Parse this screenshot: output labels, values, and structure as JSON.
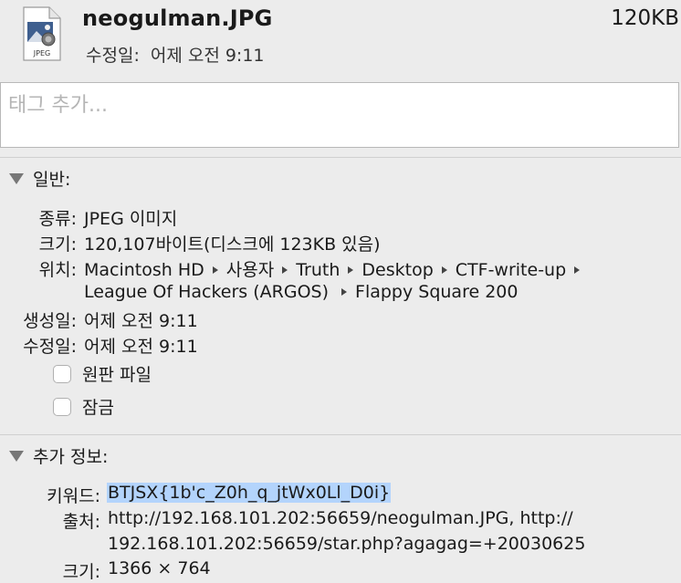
{
  "header": {
    "file_name": "neogulman.JPG",
    "file_size": "120KB",
    "modified_label": "수정일:",
    "modified_value": "어제 오전 9:11",
    "icon_caption": "JPEG"
  },
  "tag_field": {
    "placeholder": "태그 추가..."
  },
  "general": {
    "title": "일반:",
    "kind_label": "종류:",
    "kind_value": "JPEG 이미지",
    "size_label": "크기:",
    "size_value": "120,107바이트(디스크에 123KB 있음)",
    "where_label": "위치:",
    "where_path_line1": [
      "Macintosh HD",
      "사용자",
      "Truth",
      "Desktop",
      "CTF-write-up"
    ],
    "where_path_line2": [
      "League Of Hackers (ARGOS)",
      "Flappy Square 200"
    ],
    "created_label": "생성일:",
    "created_value": "어제 오전 9:11",
    "modified_label": "수정일:",
    "modified_value": "어제 오전 9:11",
    "stationery_label": "원판 파일",
    "locked_label": "잠금"
  },
  "more_info": {
    "title": "추가 정보:",
    "keywords_label": "키워드:",
    "keywords_value": "BTJSX{1b'c_Z0h_q_jtWx0Ll_D0i}",
    "source_label": "출처:",
    "source_line1": "http://192.168.101.202:56659/neogulman.JPG, http://",
    "source_line2": "192.168.101.202:56659/star.php?agagag=+20030625",
    "dimensions_label": "크기:",
    "dimensions_value": "1366 × 764"
  },
  "colors": {
    "background": "#ececec",
    "selection": "#b3d4fc"
  }
}
